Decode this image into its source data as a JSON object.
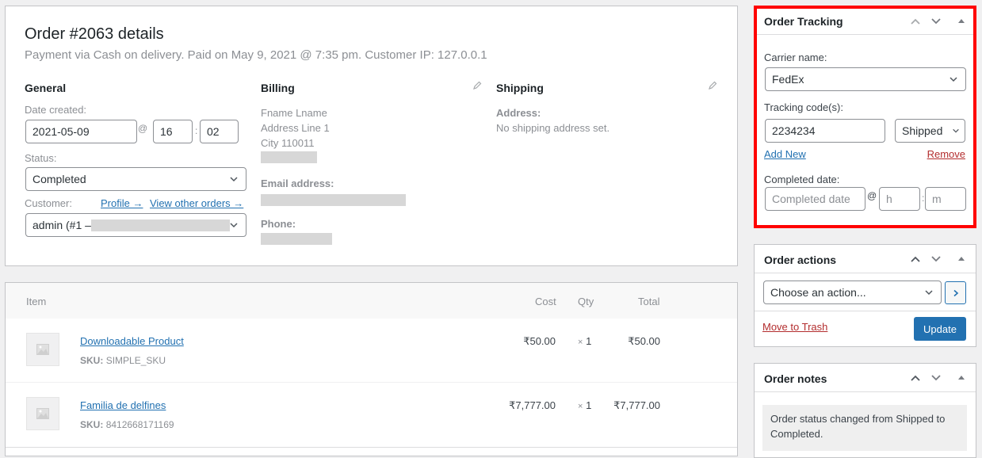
{
  "order": {
    "title": "Order #2063 details",
    "subtitle": "Payment via Cash on delivery. Paid on May 9, 2021 @ 7:35 pm. Customer IP: 127.0.0.1",
    "general": {
      "heading": "General",
      "date_label": "Date created:",
      "date_value": "2021-05-09",
      "at": "@",
      "hour": "16",
      "colon": ":",
      "minute": "02",
      "status_label": "Status:",
      "status_value": "Completed",
      "customer_label": "Customer:",
      "profile_link": "Profile →",
      "other_orders_link": "View other orders →",
      "customer_value": "admin (#1 –"
    },
    "billing": {
      "heading": "Billing",
      "name": "Fname Lname",
      "address1": "Address Line 1",
      "city": "City 110011",
      "email_label": "Email address:",
      "phone_label": "Phone:"
    },
    "shipping": {
      "heading": "Shipping",
      "address_label": "Address:",
      "address_value": "No shipping address set."
    }
  },
  "items": {
    "headers": {
      "item": "Item",
      "cost": "Cost",
      "qty": "Qty",
      "total": "Total"
    },
    "rows": [
      {
        "name": "Downloadable Product",
        "sku_label": "SKU:",
        "sku": "SIMPLE_SKU",
        "cost": "₹50.00",
        "qty_x": "×",
        "qty": "1",
        "total": "₹50.00"
      },
      {
        "name": "Familia de delfines",
        "sku_label": "SKU:",
        "sku": "8412668171169",
        "cost": "₹7,777.00",
        "qty_x": "×",
        "qty": "1",
        "total": "₹7,777.00"
      }
    ]
  },
  "tracking": {
    "title": "Order Tracking",
    "carrier_label": "Carrier name:",
    "carrier_value": "FedEx",
    "code_label": "Tracking code(s):",
    "code_value": "2234234",
    "status_value": "Shipped",
    "add_new": "Add New",
    "remove": "Remove",
    "completed_label": "Completed date:",
    "completed_placeholder": "Completed date",
    "at": "@",
    "hour_placeholder": "h",
    "colon": ":",
    "minute_placeholder": "m",
    "highlight_color": "#ff0000"
  },
  "actions": {
    "title": "Order actions",
    "select_value": "Choose an action...",
    "trash": "Move to Trash",
    "update": "Update"
  },
  "notes": {
    "title": "Order notes",
    "note1": "Order status changed from Shipped to Completed."
  }
}
